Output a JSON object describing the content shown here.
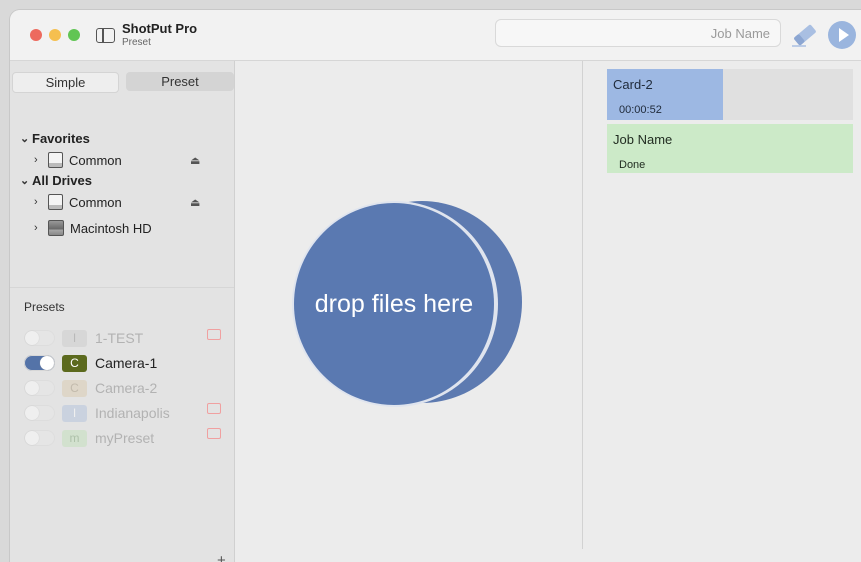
{
  "window": {
    "app_title": "ShotPut Pro",
    "app_subtitle": "Preset",
    "jobname_placeholder": "Job Name"
  },
  "sidebar": {
    "tabs": [
      {
        "label": "Simple",
        "selected": false
      },
      {
        "label": "Preset",
        "selected": true
      }
    ],
    "favorites_header": "Favorites",
    "favorites_items": [
      {
        "label": "Common",
        "icon": "drive-icon",
        "ejectable": true
      }
    ],
    "alldrives_header": "All Drives",
    "alldrives_items": [
      {
        "label": "Common",
        "icon": "drive-icon",
        "ejectable": true
      },
      {
        "label": "Macintosh HD",
        "icon": "hard-disk-icon",
        "ejectable": false
      }
    ],
    "presets_label": "Presets",
    "presets": [
      {
        "badge": "I",
        "name": "1-TEST",
        "enabled": false,
        "badge_color": "#c9c9c9",
        "badge_text_color": "#888888",
        "has_folder": true
      },
      {
        "badge": "C",
        "name": "Camera-1",
        "enabled": true,
        "badge_color": "#5c6a1e",
        "badge_text_color": "#ffffff",
        "has_folder": false
      },
      {
        "badge": "C",
        "name": "Camera-2",
        "enabled": false,
        "badge_color": "#d9c7a8",
        "badge_text_color": "#9c8a6a",
        "has_folder": false
      },
      {
        "badge": "I",
        "name": "Indianapolis",
        "enabled": false,
        "badge_color": "#aebfdc",
        "badge_text_color": "#ffffff",
        "has_folder": true
      },
      {
        "badge": "m",
        "name": "myPreset",
        "enabled": false,
        "badge_color": "#bfe0b6",
        "badge_text_color": "#6f9a66",
        "has_folder": true
      }
    ],
    "add_label": "+"
  },
  "dropzone": {
    "label": "drop files here",
    "color": "#5a79b1"
  },
  "queue": {
    "card": {
      "name": "Card-2",
      "time": "00:00:52",
      "progress": 0.47,
      "color": "#9db8e3"
    },
    "job": {
      "name": "Job Name",
      "status": "Done",
      "color": "#cceac8"
    }
  }
}
